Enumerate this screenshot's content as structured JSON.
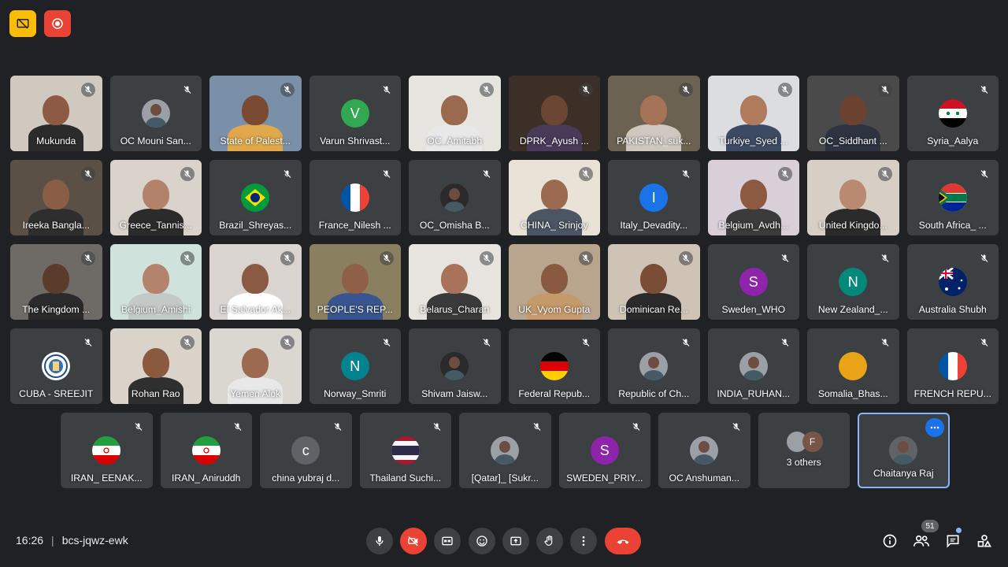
{
  "meeting": {
    "time": "16:26",
    "separator": "|",
    "code": "bcs-jqwz-ewk",
    "participant_count": "51"
  },
  "rows": [
    [
      {
        "name": "Mukunda",
        "type": "video",
        "bg": "#cfc9c0",
        "skin": "#8d5b43",
        "shirt": "#2b2b2b"
      },
      {
        "name": "OC Mouni San...",
        "type": "photo"
      },
      {
        "name": "State of Palest...",
        "type": "video",
        "bg": "#7a8fa8",
        "skin": "#7b4a32",
        "shirt": "#e0a84b"
      },
      {
        "name": "Varun Shrivast...",
        "type": "letter",
        "letter": "V",
        "color": "#33a853"
      },
      {
        "name": "OC_Amitabh",
        "type": "video",
        "bg": "#e6e4df",
        "skin": "#9a6a4e",
        "shirt": "#e8e8e8"
      },
      {
        "name": "DPRK_Ayush ...",
        "type": "video",
        "bg": "#3b2f27",
        "skin": "#6b4632",
        "shirt": "#4a3a5a"
      },
      {
        "name": "PAKISTAN_suk...",
        "type": "video",
        "bg": "#6b6252",
        "skin": "#a57355",
        "shirt": "#cfc8c0"
      },
      {
        "name": "Turkiye_Syed ...",
        "type": "video",
        "bg": "#dcdde0",
        "skin": "#b07a5c",
        "shirt": "#3d4a63"
      },
      {
        "name": "OC_Siddhant ...",
        "type": "video",
        "bg": "#4a4a4a",
        "skin": "#6b4230",
        "shirt": "#2d3340"
      },
      {
        "name": "Syria_Aalya",
        "type": "flag",
        "flag": "syria"
      }
    ],
    [
      {
        "name": "Ireeka Bangla...",
        "type": "video",
        "bg": "#5b5046",
        "skin": "#8a5d45",
        "shirt": "#2e2e2e"
      },
      {
        "name": "Greece_Tannis...",
        "type": "video",
        "bg": "#d9d3cc",
        "skin": "#b2826a",
        "shirt": "#2b2b2b"
      },
      {
        "name": "Brazil_Shreyas...",
        "type": "flag",
        "flag": "brazil"
      },
      {
        "name": "France_Nilesh ...",
        "type": "flag",
        "flag": "france"
      },
      {
        "name": "OC_Omisha B...",
        "type": "photo-dark"
      },
      {
        "name": "CHINA_ Srinjoy",
        "type": "video",
        "bg": "#e9e3d7",
        "skin": "#9b6a50",
        "shirt": "#4b5563"
      },
      {
        "name": "Italy_Devadity...",
        "type": "letter",
        "letter": "I",
        "color": "#1a73e8"
      },
      {
        "name": "Belgium_Avdh...",
        "type": "video",
        "bg": "#d8cfd8",
        "skin": "#8c5a40",
        "shirt": "#3b3b3b"
      },
      {
        "name": "United Kingdo...",
        "type": "video",
        "bg": "#d7cfc6",
        "skin": "#b98a70",
        "shirt": "#2b2b2b"
      },
      {
        "name": "South Africa_ ...",
        "type": "flag",
        "flag": "southafrica"
      }
    ],
    [
      {
        "name": "The Kingdom ...",
        "type": "video",
        "bg": "#6e6a66",
        "skin": "#5b3b2b",
        "shirt": "#2a2a2a"
      },
      {
        "name": "Belgium_Amishi",
        "type": "video",
        "bg": "#cfe3dc",
        "skin": "#b4836b",
        "shirt": "#c2c9c6"
      },
      {
        "name": "El Salvador Ak...",
        "type": "video",
        "bg": "#d9d4cf",
        "skin": "#8a5a42",
        "shirt": "#ffffff"
      },
      {
        "name": "PEOPLE'S REP...",
        "type": "video",
        "bg": "#8a8060",
        "skin": "#8f6047",
        "shirt": "#39558f"
      },
      {
        "name": "Belarus_Charan",
        "type": "video",
        "bg": "#e7e4e0",
        "skin": "#a87358",
        "shirt": "#3a3a3a"
      },
      {
        "name": "UK_Vyom Gupta",
        "type": "video",
        "bg": "#b9a58e",
        "skin": "#8a5a40",
        "shirt": "#c59a6a"
      },
      {
        "name": "Dominican Re...",
        "type": "video",
        "bg": "#cfc3b6",
        "skin": "#7a4d36",
        "shirt": "#2a2a2a"
      },
      {
        "name": "Sweden_WHO",
        "type": "letter",
        "letter": "S",
        "color": "#8e24aa"
      },
      {
        "name": "New Zealand_...",
        "type": "letter",
        "letter": "N",
        "color": "#00897b"
      },
      {
        "name": "Australia Shubh",
        "type": "flag",
        "flag": "australia"
      }
    ],
    [
      {
        "name": "CUBA - SREEJIT",
        "type": "flag",
        "flag": "emblem"
      },
      {
        "name": "Rohan Rao",
        "type": "video",
        "bg": "#d9d3c9",
        "skin": "#8a5a40",
        "shirt": "#2f2f2f"
      },
      {
        "name": "Yemen Alok",
        "type": "video",
        "bg": "#dad6d0",
        "skin": "#9b6a50",
        "shirt": "#e8e8e8"
      },
      {
        "name": "Norway_Smriti",
        "type": "letter",
        "letter": "N",
        "color": "#00838f"
      },
      {
        "name": "Shivam Jaisw...",
        "type": "photo-dark"
      },
      {
        "name": "Federal Repub...",
        "type": "flag",
        "flag": "germany"
      },
      {
        "name": "Republic of Ch...",
        "type": "photo"
      },
      {
        "name": "INDIA_RUHAN...",
        "type": "photo"
      },
      {
        "name": "Somalia_Bhas...",
        "type": "letter",
        "letter": "",
        "color": "#e8a317"
      },
      {
        "name": "FRENCH REPU...",
        "type": "flag",
        "flag": "france"
      }
    ],
    [
      {
        "name": "IRAN_ EENAK...",
        "type": "flag",
        "flag": "iran"
      },
      {
        "name": "IRAN_ Aniruddh",
        "type": "flag",
        "flag": "iran"
      },
      {
        "name": "china yubraj d...",
        "type": "letter",
        "letter": "c",
        "color": "#5f6368"
      },
      {
        "name": "Thailand Suchi...",
        "type": "flag",
        "flag": "thailand"
      },
      {
        "name": "[Qatar]_ [Sukr...",
        "type": "photo"
      },
      {
        "name": "SWEDEN_PRIY...",
        "type": "letter",
        "letter": "S",
        "color": "#8e24aa"
      },
      {
        "name": "OC Anshuman...",
        "type": "photo"
      },
      {
        "name": "3 others",
        "type": "others",
        "letter": "F"
      },
      {
        "name": "Chaitanya Raj",
        "type": "selected-photo"
      }
    ]
  ],
  "controls": {
    "mic": "mic-icon",
    "camera_off": "camera-off-icon",
    "captions": "captions-icon",
    "emoji": "emoji-icon",
    "present": "present-icon",
    "raise_hand": "hand-icon",
    "more": "more-vert-icon",
    "end_call": "end-call-icon"
  },
  "colors": {
    "background": "#202124",
    "tile": "#3c4043",
    "accent": "#8ab4f8",
    "danger": "#ea4335",
    "warn": "#fbbc04"
  }
}
